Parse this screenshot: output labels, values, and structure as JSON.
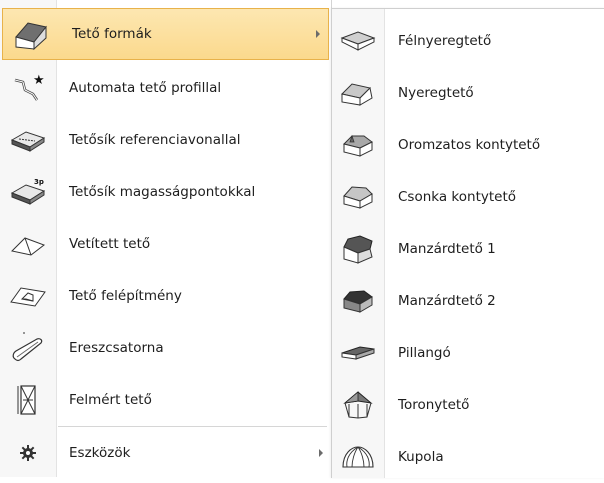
{
  "main_menu": {
    "items": [
      {
        "label": "Tető formák",
        "icon": "gable-roof-icon",
        "submenu": true,
        "active": true
      },
      {
        "label": "Automata tető profillal",
        "icon": "auto-roof-profile-icon"
      },
      {
        "label": "Tetősík referenciavonallal",
        "icon": "roof-plane-reference-line-icon"
      },
      {
        "label": "Tetősík magasságpontokkal",
        "icon": "roof-plane-height-points-icon"
      },
      {
        "label": "Vetített tető",
        "icon": "projected-roof-icon"
      },
      {
        "label": "Tető felépítmény",
        "icon": "roof-superstructure-icon"
      },
      {
        "label": "Ereszcsatorna",
        "icon": "gutter-icon"
      },
      {
        "label": "Felmért tető",
        "icon": "surveyed-roof-icon"
      },
      {
        "label": "Eszközök",
        "icon": "gear-icon",
        "submenu": true
      }
    ]
  },
  "sub_menu": {
    "items": [
      {
        "label": "Félnyeregtető",
        "icon": "lean-to-roof-icon"
      },
      {
        "label": "Nyeregtető",
        "icon": "gable-roof-icon"
      },
      {
        "label": "Oromzatos kontytető",
        "icon": "gablet-hip-roof-icon"
      },
      {
        "label": "Csonka kontytető",
        "icon": "half-hip-roof-icon"
      },
      {
        "label": "Manzárdtető 1",
        "icon": "mansard-roof-icon"
      },
      {
        "label": "Manzárdtető 2",
        "icon": "mansard-roof-alt-icon"
      },
      {
        "label": "Pillangó",
        "icon": "butterfly-roof-icon"
      },
      {
        "label": "Toronytető",
        "icon": "tower-roof-icon"
      },
      {
        "label": "Kupola",
        "icon": "dome-icon"
      }
    ]
  },
  "colors": {
    "highlight_top": "#fde7b1",
    "highlight_bottom": "#fbd98d",
    "highlight_border": "#e8b24a"
  }
}
